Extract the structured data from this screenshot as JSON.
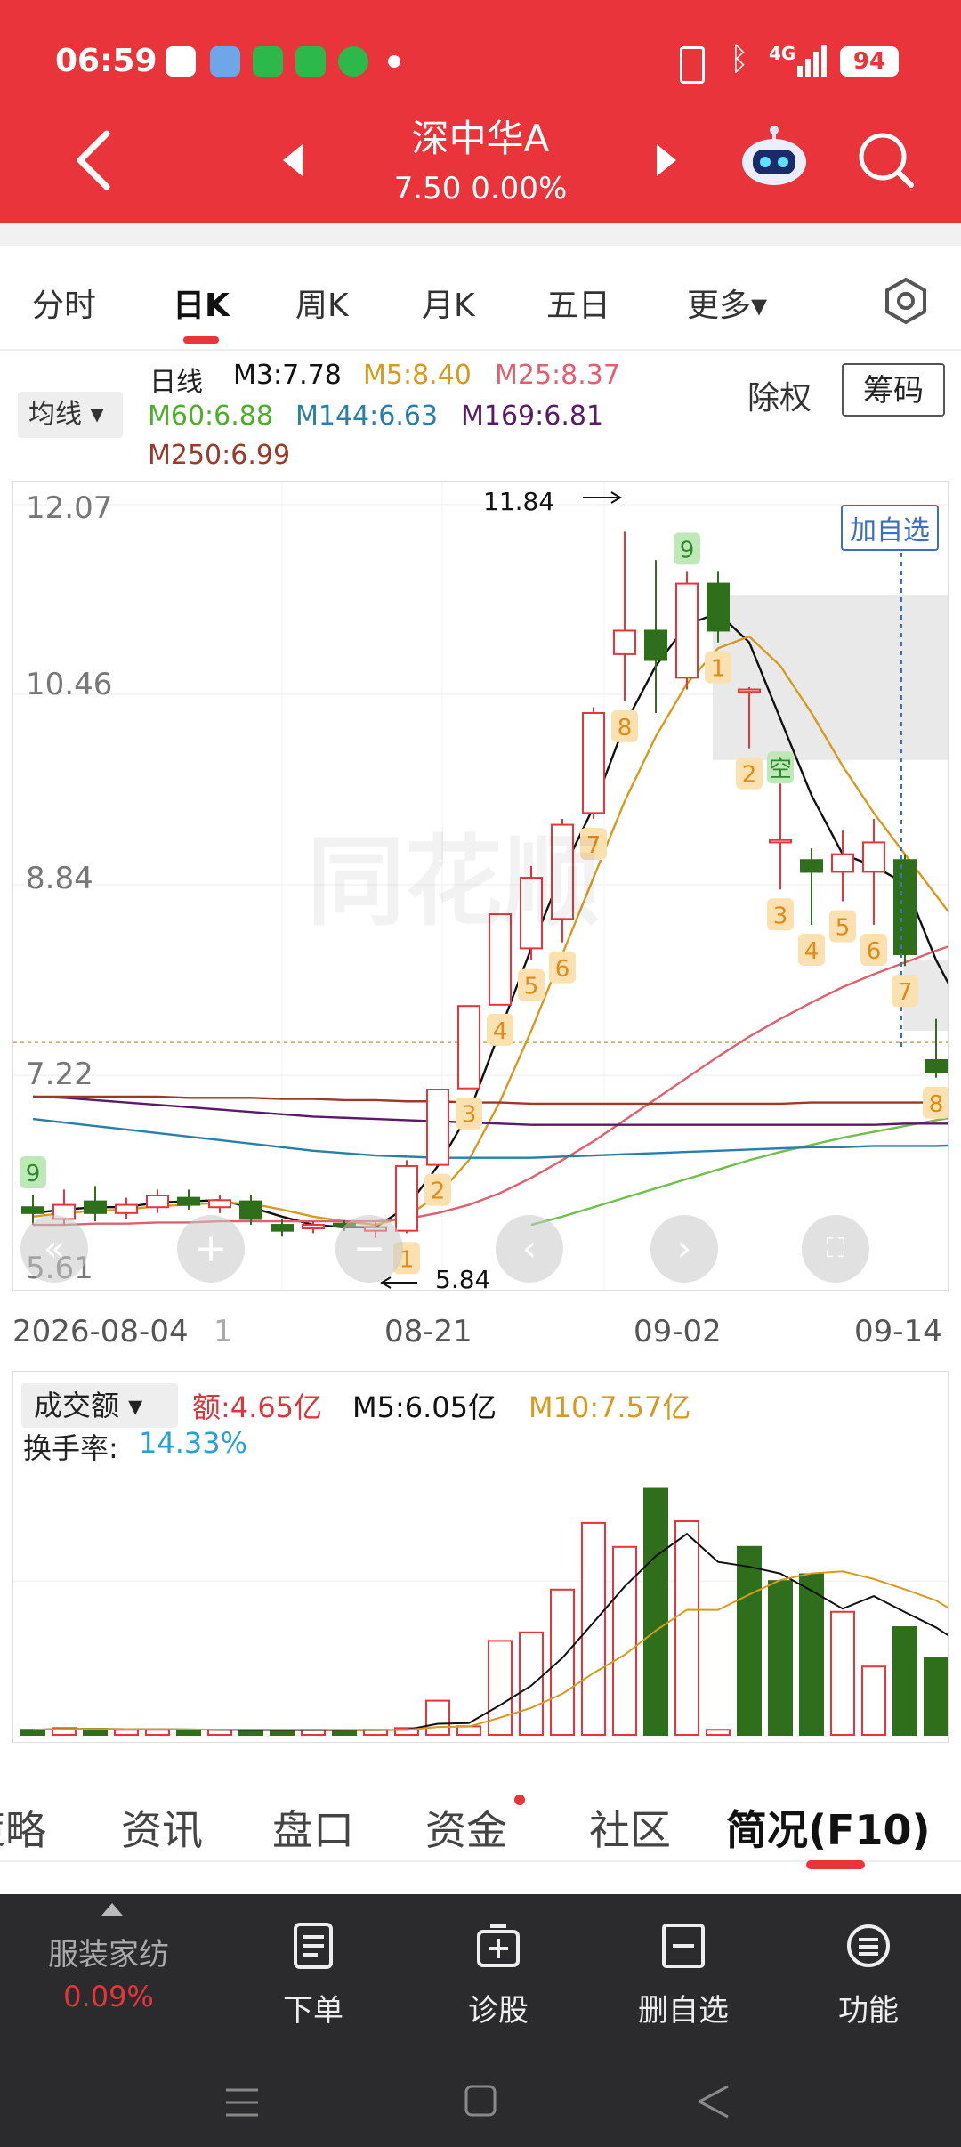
{
  "status": {
    "time": "06:59",
    "battery": "94",
    "signal": "4G"
  },
  "header": {
    "name": "深中华A",
    "price_change": "7.50 0.00%"
  },
  "tabs": [
    {
      "label": "分时"
    },
    {
      "label": "日K"
    },
    {
      "label": "周K"
    },
    {
      "label": "月K"
    },
    {
      "label": "五日"
    },
    {
      "label": "更多▾"
    }
  ],
  "legend": {
    "ma_select": "均线 ▾",
    "period": "日线",
    "m3": "M3:7.78",
    "m5": "M5:8.40",
    "m25": "M25:8.37",
    "m60": "M60:6.88",
    "m144": "M144:6.63",
    "m169": "M169:6.81",
    "m250": "M250:6.99",
    "chuquan": "除权",
    "chouma": "筹码"
  },
  "colors": {
    "red": "#e8343a",
    "green": "#2f6e1a",
    "m3": "#111111",
    "m5": "#d89a1e",
    "m25": "#e06070",
    "m60": "#6fbf4a",
    "m144": "#2a7fa8",
    "m169": "#5a1a6a",
    "m250": "#9a3a2a"
  },
  "chart": {
    "y_ticks": [
      "12.07",
      "10.46",
      "8.84",
      "7.22",
      "5.61"
    ],
    "x_ticks": [
      "2026-08-04",
      "1",
      "08-21",
      "09-02",
      "09-14"
    ],
    "high_label": "11.84",
    "low_label": "5.84",
    "add_watch": "加自选",
    "watermark": "同花顺"
  },
  "chart_data": {
    "type": "candlestick",
    "ylim": [
      5.61,
      12.07
    ],
    "candles": [
      {
        "o": 6.1,
        "c": 6.05,
        "h": 6.2,
        "l": 5.95
      },
      {
        "o": 6.0,
        "c": 6.12,
        "h": 6.25,
        "l": 5.95
      },
      {
        "o": 6.15,
        "c": 6.05,
        "h": 6.28,
        "l": 5.98
      },
      {
        "o": 6.05,
        "c": 6.12,
        "h": 6.18,
        "l": 6.0
      },
      {
        "o": 6.1,
        "c": 6.2,
        "h": 6.25,
        "l": 6.05
      },
      {
        "o": 6.18,
        "c": 6.12,
        "h": 6.25,
        "l": 6.08
      },
      {
        "o": 6.1,
        "c": 6.16,
        "h": 6.2,
        "l": 6.05
      },
      {
        "o": 6.15,
        "c": 6.0,
        "h": 6.2,
        "l": 5.95
      },
      {
        "o": 5.95,
        "c": 5.9,
        "h": 6.0,
        "l": 5.85
      },
      {
        "o": 5.92,
        "c": 5.95,
        "h": 5.98,
        "l": 5.88
      },
      {
        "o": 5.96,
        "c": 5.94,
        "h": 5.99,
        "l": 5.9
      },
      {
        "o": 5.9,
        "c": 5.93,
        "h": 5.97,
        "l": 5.84
      },
      {
        "o": 5.9,
        "c": 6.45,
        "h": 6.5,
        "l": 5.88
      },
      {
        "o": 6.46,
        "c": 7.1,
        "h": 7.1,
        "l": 6.46
      },
      {
        "o": 7.11,
        "c": 7.81,
        "h": 7.81,
        "l": 7.11
      },
      {
        "o": 7.82,
        "c": 8.59,
        "h": 8.59,
        "l": 7.82
      },
      {
        "o": 8.3,
        "c": 8.9,
        "h": 9.0,
        "l": 8.2
      },
      {
        "o": 8.55,
        "c": 9.35,
        "h": 9.4,
        "l": 8.35
      },
      {
        "o": 9.45,
        "c": 10.3,
        "h": 10.35,
        "l": 9.4
      },
      {
        "o": 10.8,
        "c": 11.0,
        "h": 11.84,
        "l": 10.4
      },
      {
        "o": 11.0,
        "c": 10.75,
        "h": 11.6,
        "l": 10.3
      },
      {
        "o": 10.6,
        "c": 11.4,
        "h": 11.5,
        "l": 10.5
      },
      {
        "o": 11.4,
        "c": 11.0,
        "h": 11.5,
        "l": 10.9
      },
      {
        "o": 10.48,
        "c": 10.5,
        "h": 10.52,
        "l": 10.0
      },
      {
        "o": 9.2,
        "c": 9.22,
        "h": 9.7,
        "l": 8.8
      },
      {
        "o": 9.05,
        "c": 8.95,
        "h": 9.15,
        "l": 8.5
      },
      {
        "o": 8.95,
        "c": 9.1,
        "h": 9.3,
        "l": 8.7
      },
      {
        "o": 8.95,
        "c": 9.2,
        "h": 9.4,
        "l": 8.5
      },
      {
        "o": 9.05,
        "c": 8.25,
        "h": 9.1,
        "l": 8.15
      },
      {
        "o": 7.35,
        "c": 7.25,
        "h": 7.7,
        "l": 7.2
      },
      {
        "o": 7.5,
        "c": 7.5,
        "h": 7.65,
        "l": 7.15
      }
    ],
    "ma": {
      "m3": [
        6.05,
        6.08,
        6.1,
        6.1,
        6.14,
        6.15,
        6.16,
        6.1,
        6.02,
        5.95,
        5.93,
        5.93,
        6.1,
        6.45,
        6.9,
        7.6,
        8.3,
        8.95,
        9.5,
        10.2,
        10.7,
        11.05,
        11.15,
        10.9,
        10.25,
        9.6,
        9.1,
        9.0,
        8.85,
        8.2,
        7.7
      ],
      "m5": [
        6.02,
        6.05,
        6.07,
        6.08,
        6.11,
        6.12,
        6.14,
        6.13,
        6.08,
        6.02,
        5.98,
        5.95,
        6.02,
        6.2,
        6.5,
        7.0,
        7.6,
        8.25,
        8.9,
        9.55,
        10.1,
        10.55,
        10.85,
        10.95,
        10.7,
        10.3,
        9.85,
        9.45,
        9.1,
        8.75,
        8.4
      ],
      "m25": [
        5.95,
        5.95,
        5.96,
        5.96,
        5.97,
        5.97,
        5.98,
        5.98,
        5.98,
        5.98,
        5.98,
        5.98,
        6.0,
        6.05,
        6.12,
        6.22,
        6.35,
        6.5,
        6.66,
        6.84,
        7.02,
        7.2,
        7.38,
        7.55,
        7.7,
        7.84,
        7.97,
        8.08,
        8.18,
        8.28,
        8.37
      ],
      "m60": [
        null,
        null,
        null,
        null,
        null,
        null,
        null,
        null,
        null,
        null,
        null,
        null,
        null,
        null,
        null,
        null,
        5.95,
        6.02,
        6.1,
        6.18,
        6.26,
        6.34,
        6.42,
        6.5,
        6.57,
        6.63,
        6.69,
        6.74,
        6.79,
        6.84,
        6.88
      ],
      "m144": [
        6.85,
        6.82,
        6.79,
        6.76,
        6.73,
        6.7,
        6.67,
        6.64,
        6.61,
        6.58,
        6.56,
        6.54,
        6.53,
        6.52,
        6.52,
        6.52,
        6.52,
        6.53,
        6.54,
        6.55,
        6.56,
        6.57,
        6.58,
        6.59,
        6.6,
        6.61,
        6.61,
        6.62,
        6.62,
        6.62,
        6.63
      ],
      "m169": [
        7.04,
        7.03,
        7.01,
        6.99,
        6.97,
        6.95,
        6.93,
        6.91,
        6.89,
        6.87,
        6.86,
        6.85,
        6.84,
        6.83,
        6.82,
        6.81,
        6.8,
        6.8,
        6.8,
        6.8,
        6.8,
        6.8,
        6.8,
        6.8,
        6.8,
        6.8,
        6.8,
        6.8,
        6.81,
        6.81,
        6.81
      ],
      "m250": [
        7.04,
        7.04,
        7.04,
        7.04,
        7.04,
        7.03,
        7.03,
        7.03,
        7.02,
        7.02,
        7.01,
        7.01,
        7.0,
        7.0,
        6.99,
        6.99,
        6.98,
        6.98,
        6.98,
        6.98,
        6.98,
        6.98,
        6.98,
        6.98,
        6.98,
        6.99,
        6.99,
        6.99,
        6.99,
        6.99,
        6.99
      ]
    },
    "markers": [
      {
        "i": 0,
        "t": "9",
        "green": true
      },
      {
        "i": 12,
        "t": "1"
      },
      {
        "i": 13,
        "t": "2"
      },
      {
        "i": 14,
        "t": "3"
      },
      {
        "i": 15,
        "t": "4"
      },
      {
        "i": 16,
        "t": "5"
      },
      {
        "i": 17,
        "t": "6"
      },
      {
        "i": 18,
        "t": "7"
      },
      {
        "i": 19,
        "t": "8"
      },
      {
        "i": 21,
        "t": "9",
        "green": true
      },
      {
        "i": 22,
        "t": "1"
      },
      {
        "i": 23,
        "t": "2"
      },
      {
        "i": 24,
        "t": "3"
      },
      {
        "i": 25,
        "t": "4"
      },
      {
        "i": 26,
        "t": "5"
      },
      {
        "i": 27,
        "t": "6"
      },
      {
        "i": 28,
        "t": "7"
      },
      {
        "i": 29,
        "t": "8"
      },
      {
        "i": 24,
        "t": "空",
        "green": true,
        "top": true
      }
    ],
    "volume": {
      "labels": {
        "amount": "额:4.65亿",
        "m5": "M5:6.05亿",
        "m10": "M10:7.57亿",
        "turnover_label": "换手率:",
        "turnover": "14.33%"
      },
      "bars": [
        0.3,
        0.4,
        0.35,
        0.3,
        0.3,
        0.25,
        0.3,
        0.3,
        0.25,
        0.3,
        0.25,
        0.3,
        0.4,
        2.0,
        0.5,
        5.5,
        6.0,
        8.5,
        12.4,
        11.0,
        14.4,
        12.5,
        0.3,
        11.0,
        9.0,
        9.4,
        7.2,
        4.0,
        6.3,
        4.5,
        3.5
      ],
      "up": [
        false,
        true,
        false,
        true,
        true,
        false,
        true,
        false,
        false,
        true,
        false,
        true,
        true,
        true,
        true,
        true,
        true,
        true,
        true,
        true,
        false,
        true,
        true,
        false,
        false,
        false,
        true,
        true,
        false,
        false,
        true
      ]
    }
  },
  "bottom_tabs": [
    {
      "label": "策略"
    },
    {
      "label": "资讯"
    },
    {
      "label": "盘口"
    },
    {
      "label": "资金"
    },
    {
      "label": "社区"
    },
    {
      "label": "简况(F10)"
    }
  ],
  "bottom_bar": {
    "sector": "服装家纺",
    "sector_change": "0.09%",
    "items": [
      {
        "label": "下单"
      },
      {
        "label": "诊股"
      },
      {
        "label": "删自选"
      },
      {
        "label": "功能"
      }
    ]
  }
}
